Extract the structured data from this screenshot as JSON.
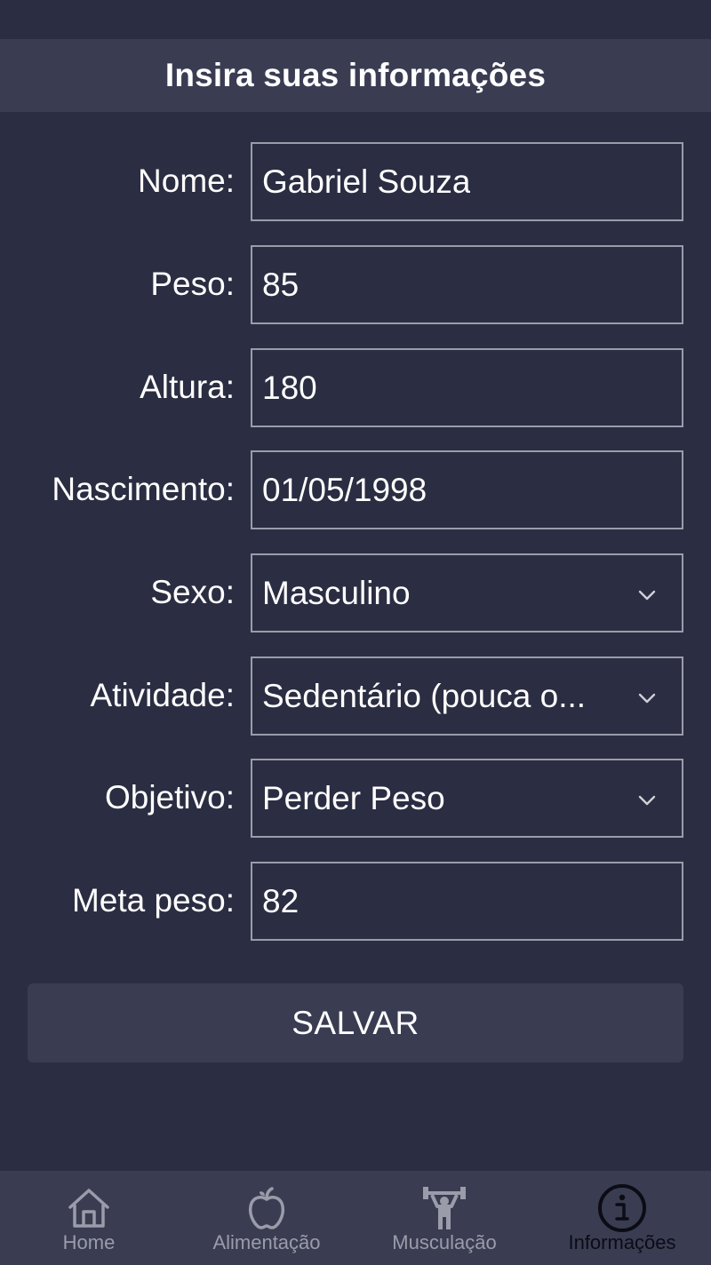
{
  "header": {
    "title": "Insira suas informações"
  },
  "form": {
    "nome": {
      "label": "Nome:",
      "value": "Gabriel Souza"
    },
    "peso": {
      "label": "Peso:",
      "value": "85"
    },
    "altura": {
      "label": "Altura:",
      "value": "180"
    },
    "nascimento": {
      "label": "Nascimento:",
      "value": "01/05/1998"
    },
    "sexo": {
      "label": "Sexo:",
      "value": "Masculino"
    },
    "atividade": {
      "label": "Atividade:",
      "value": "Sedentário (pouca o..."
    },
    "objetivo": {
      "label": "Objetivo:",
      "value": "Perder Peso"
    },
    "meta_peso": {
      "label": "Meta peso:",
      "value": "82"
    }
  },
  "save_label": "SALVAR",
  "nav": {
    "items": [
      {
        "label": "Home",
        "icon": "home-icon"
      },
      {
        "label": "Alimentação",
        "icon": "apple-icon"
      },
      {
        "label": "Musculação",
        "icon": "weightlifter-icon"
      },
      {
        "label": "Informações",
        "icon": "info-icon"
      }
    ],
    "active": "Informações"
  },
  "colors": {
    "background": "#2b2d42",
    "surface": "#3a3c52",
    "border": "#9a9caa",
    "inactive": "#9a9caa",
    "active": "#0b0c14"
  }
}
